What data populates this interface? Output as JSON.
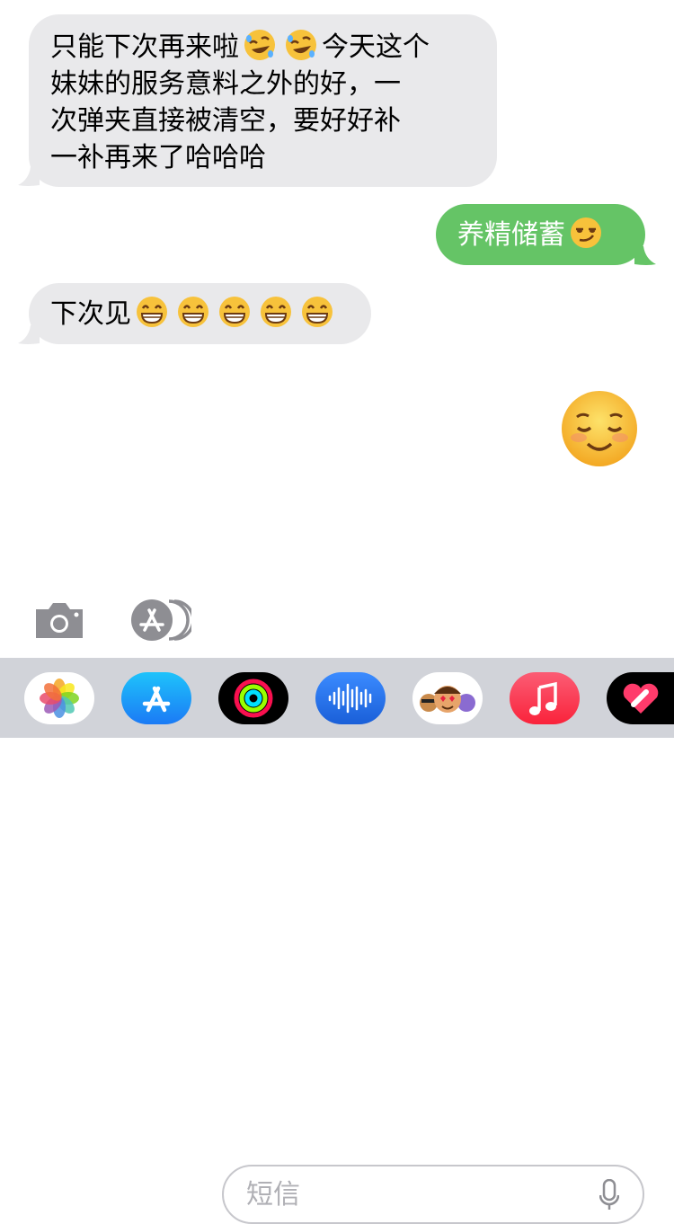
{
  "messages": [
    {
      "direction": "incoming",
      "text": "只能下次再来啦🤣🤣今天这个妹妹的服务意料之外的好，一次弹夹直接被清空，要好好补一补再来了哈哈哈"
    },
    {
      "direction": "outgoing",
      "text": "养精储蓄",
      "emoji": "smirking-face"
    },
    {
      "direction": "incoming",
      "text": "下次见",
      "emoji": "grinning-face",
      "emoji_count": 5
    },
    {
      "direction": "outgoing",
      "emoji_only": "smiling-face"
    }
  ],
  "lines_msg1": [
    "只能下次再来啦",
    "今天这个",
    "妹妹的服务意料之外的好，一",
    "次弹夹直接被清空，要好好补",
    "一补再来了哈哈哈"
  ],
  "msg2": {
    "text": "养精储蓄"
  },
  "msg3": {
    "text": "下次见"
  },
  "input": {
    "placeholder": "短信"
  },
  "toolbar": {
    "camera_icon": "camera-icon",
    "apps_icon": "app-store-icon",
    "mic_icon": "microphone-icon"
  },
  "dock": {
    "apps": [
      "photos-icon",
      "app-store-icon",
      "activity-icon",
      "voice-memos-icon",
      "memoji-icon",
      "music-icon",
      "digital-touch-icon"
    ]
  },
  "colors": {
    "incoming": "#e9e9eb",
    "outgoing": "#65c466",
    "dock": "#d1d3d9"
  }
}
